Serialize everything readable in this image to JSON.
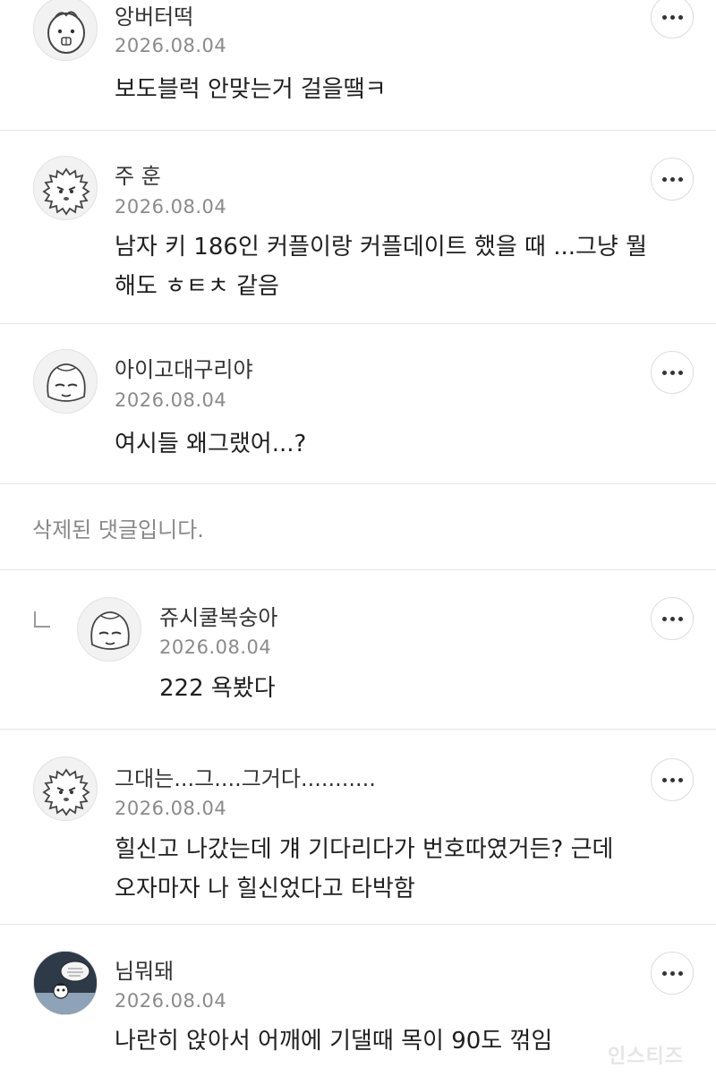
{
  "comments": [
    {
      "nickname": "앙버터떡",
      "date": "2026.08.04",
      "text": "보도블럭 안맞는거 걸을땤ㅋ",
      "avatar": "bread-face-avatar"
    },
    {
      "nickname": "주 훈",
      "date": "2026.08.04",
      "text": "남자 키 186인 커플이랑 커플데이트 했을 때 ...그냥 뭘 해도 ㅎㅌㅊ 같음",
      "avatar": "hedgehog-avatar"
    },
    {
      "nickname": "아이고대구리야",
      "date": "2026.08.04",
      "text": "여시들 왜그랬어...?",
      "avatar": "sleepy-fox-avatar"
    },
    {
      "deleted_text": "삭제된 댓글입니다."
    },
    {
      "nickname": "쥬시쿨복숭아",
      "date": "2026.08.04",
      "text": "222 욕봤다",
      "avatar": "sleepy-fox-avatar",
      "is_reply": true
    },
    {
      "nickname": "그대는...그....그거다...........",
      "date": "2026.08.04",
      "text": "힐신고 나갔는데 걔 기다리다가 번호따였거든? 근데 오자마자 나 힐신었다고 타박함",
      "avatar": "hedgehog-avatar"
    },
    {
      "nickname": "님뭐돼",
      "date": "2026.08.04",
      "text": "나란히 앉아서 어깨에 기댈때 목이 90도 꺾임",
      "avatar": "comic-photo-avatar"
    }
  ],
  "more_button_label": "더보기",
  "watermark": "인스티즈"
}
